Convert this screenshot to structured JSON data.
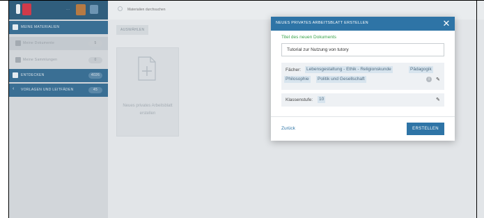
{
  "sidebar": {
    "items": [
      {
        "label": "MEINE MATERIALIEN",
        "badge": ""
      },
      {
        "label": "Meine Dokumente",
        "badge": "5"
      },
      {
        "label": "Meine Sammlungen",
        "badge": "0"
      },
      {
        "label": "ENTDECKEN",
        "badge": "4026"
      },
      {
        "label": "VORLAGEN UND LEITFÄDEN",
        "badge": "45"
      }
    ]
  },
  "search": {
    "placeholder": "Materialien durchsuchen"
  },
  "main": {
    "tab_label": "AUSWÄHLEN",
    "new_sheet_tile": "Neues privates Arbeitsblatt erstellen"
  },
  "modal": {
    "title": "NEUES PRIVATES ARBEITSBLATT ERSTELLEN",
    "close_symbol": "✕",
    "title_field_label": "Titel des neuen Dokuments",
    "title_field_value": "Tutorial zur Nutzung von tutory",
    "subjects_label": "Fächer:",
    "subjects": [
      "Lebensgestaltung - Ethik - Religionskunde",
      "Pädagogik",
      "Philosophie",
      "Politik und Gesellschaft"
    ],
    "grade_label": "Klassenstufe:",
    "grade_value": "10",
    "back_label": "Zurück",
    "create_label": "ERSTELLEN"
  },
  "colors": {
    "primary": "#2e74a6",
    "sidebar_dark": "#3a6f94",
    "title_label_green": "#38a34a"
  }
}
